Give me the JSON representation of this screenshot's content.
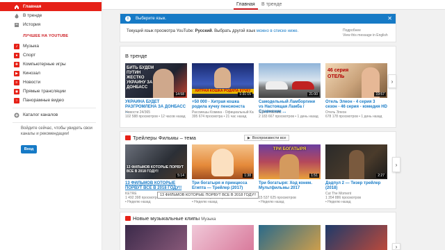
{
  "top_tabs": [
    {
      "label": "Главная",
      "active": true
    },
    {
      "label": "В тренде",
      "active": false
    }
  ],
  "sidebar": {
    "items": [
      {
        "label": "Главная",
        "icon": "home-icon",
        "active": true
      },
      {
        "label": "В тренде",
        "icon": "fire-icon",
        "active": false
      },
      {
        "label": "История",
        "icon": "history-icon",
        "active": false
      }
    ],
    "best_heading": "ЛУЧШЕЕ НА YOUTUBE",
    "best_items": [
      {
        "label": "Музыка",
        "icon": "music-icon"
      },
      {
        "label": "Спорт",
        "icon": "sports-icon"
      },
      {
        "label": "Компьютерные игры",
        "icon": "gaming-icon"
      },
      {
        "label": "Кинозал",
        "icon": "movies-icon"
      },
      {
        "label": "Новости",
        "icon": "news-icon"
      },
      {
        "label": "Прямые трансляции",
        "icon": "live-icon"
      },
      {
        "label": "Панорамные видео",
        "icon": "360-video-icon"
      }
    ],
    "catalog": "Каталог каналов",
    "signin_text": "Войдите сейчас, чтобы увидеть свои каналы и рекомендации!",
    "login_button": "Вход"
  },
  "language_notice": {
    "title": "Выберите язык.",
    "text_before": "Текущий язык просмотра YouTube: ",
    "current_language": "Русский",
    "text_middle": ". Выбрать другой язык ",
    "link": "можно в списке ниже.",
    "more_label": "Подробнее",
    "english_link": "View this message in English"
  },
  "shelves": {
    "trending": {
      "title": "В тренде",
      "videos": [
        {
          "title": "УКРАИНА БУДЕТ РАЗГРОМЛЕНА ЗА ДОНБАСС ...",
          "channel": "Новости 24/365",
          "meta": "102 588 просмотров • 12 часов назад",
          "duration": "14:58",
          "thumb_text": "БИТЬ БУДЕМ  ПУТИН ЖЕСТКО  УКРАИНУ ЗА ДОНБАСС"
        },
        {
          "title": "+50 000 - Хитрая кошка родила кучку пенсионста",
          "channel": "Рассмешы Комика - Официальный Канал",
          "meta": "395 674 просмотра • 21 час назад",
          "duration": "1:31:15",
          "thumb_text": "ХИТРАЯ КОШКА РОДИЛА КУЧКУ"
        },
        {
          "title": "Самодельный Ламборгини vs Настоящая Ламба / Сравнение ...",
          "channel": "SJA STREKAL",
          "meta": "2 183 667 просмотров • 1 день назад",
          "duration": "21:00",
          "thumb_text": ""
        },
        {
          "title": "Отель Элеон - 4 серия 3 сезон - 46 серия - комедия HD",
          "channel": "Отель Элеон",
          "meta": "678 178 просмотров • 1 день назад",
          "duration": "19:57",
          "thumb_text": "46 серия  ОТЕЛЬ"
        }
      ]
    },
    "trailers": {
      "title": "Трейлеры Фильмы – тема",
      "play_all": "Воспроизвести все",
      "videos": [
        {
          "title": "13 ФИЛЬМОВ КОТОРЫЕ ПОРВУТ ВСЕ В 2018 ГОДУ!!",
          "channel": "KETRE",
          "meta": "1 492 398 просмотров",
          "time": "Неделю назад",
          "duration": "5:14",
          "thumb_text": "13 ФИЛЬМОВ КОТОРЫЕ ПОРВУТ ВСЕ В 2018 ГОДУ!!"
        },
        {
          "title": "Три богатыря и принцесса Египта — Трейлер (2017)",
          "channel": "",
          "meta": "5 479 980 просмотров",
          "time": "Неделю назад",
          "duration": "1:38",
          "thumb_text": ""
        },
        {
          "title": "Три богатыря: Ход конем. Мультфильмы 2017",
          "channel": "",
          "meta": "15 537 625 просмотров",
          "time": "Неделю назад",
          "duration": "1:51",
          "thumb_text": "ТРИ БОГАТЫРЯ"
        },
        {
          "title": "Дэдпул 2 — Тизер трейлер (2018)",
          "channel": "Cut The Moment",
          "meta": "1 354 886 просмотров",
          "time": "Неделю назад",
          "duration": "2:27",
          "thumb_text": ""
        }
      ],
      "tooltip": "13 ФИЛЬМОВ КОТОРЫЕ ПОРВУТ ВСЕ В 2018 ГОДУ!!"
    },
    "music": {
      "title": "Новые музыкальные клипы",
      "sub": "Музыка"
    }
  },
  "colors": {
    "accent": "#e62117",
    "link": "#167ac6"
  }
}
